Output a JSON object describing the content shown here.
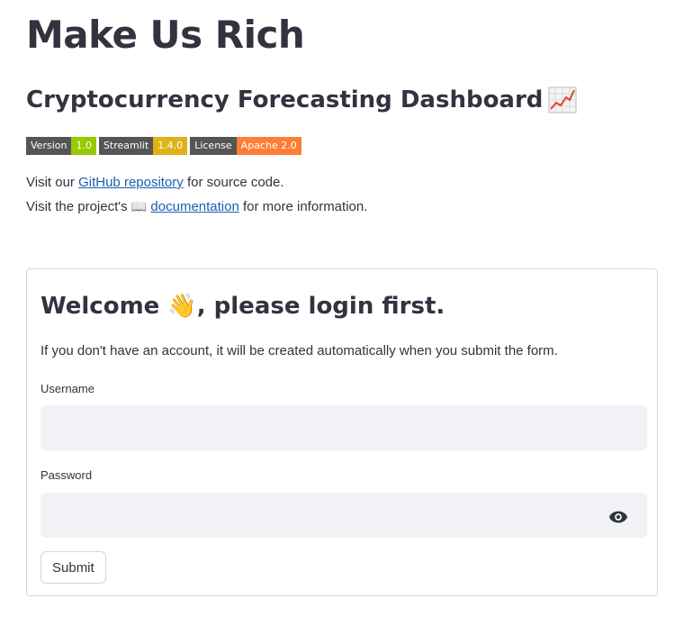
{
  "header": {
    "title": "Make Us Rich",
    "subtitle": "Cryptocurrency Forecasting Dashboard",
    "subtitle_icon": "chart-increasing-icon"
  },
  "badges": [
    {
      "key": "Version",
      "value": "1.0",
      "color": "#97ca00"
    },
    {
      "key": "Streamlit",
      "value": "1.4.0",
      "color": "#dfb317"
    },
    {
      "key": "License",
      "value": "Apache 2.0",
      "color": "#fe7d37"
    }
  ],
  "links": {
    "line1_prefix": "Visit our ",
    "github_label": "GitHub repository",
    "line1_suffix": " for source code.",
    "line2_prefix": "Visit the project's ",
    "docs_icon": "📖",
    "docs_label": "documentation",
    "line2_suffix": " for more information."
  },
  "login_form": {
    "welcome_prefix": "Welcome ",
    "welcome_emoji": "👋",
    "welcome_suffix": ", please login first.",
    "info": "If you don't have an account, it will be created automatically when you submit the form.",
    "username_label": "Username",
    "username_value": "",
    "password_label": "Password",
    "password_value": "",
    "submit_label": "Submit"
  },
  "colors": {
    "text": "#31333f",
    "link": "#1b5fae",
    "input_bg": "#f0f2f6",
    "border": "#d6d6d9"
  }
}
